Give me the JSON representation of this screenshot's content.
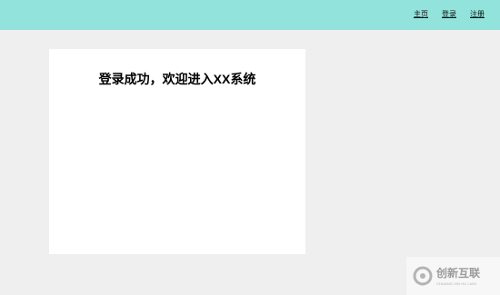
{
  "nav": {
    "items": [
      {
        "label": "主页"
      },
      {
        "label": "登录"
      },
      {
        "label": "注册"
      }
    ]
  },
  "main": {
    "message": "登录成功，欢迎进入XX系统"
  },
  "watermark": {
    "title": "创新互联",
    "subtitle": "CHUANG XIN HU LIAN",
    "icon": "logo-icon"
  },
  "colors": {
    "header_bg": "#92e3dc",
    "page_bg": "#efefef",
    "card_bg": "#ffffff"
  }
}
